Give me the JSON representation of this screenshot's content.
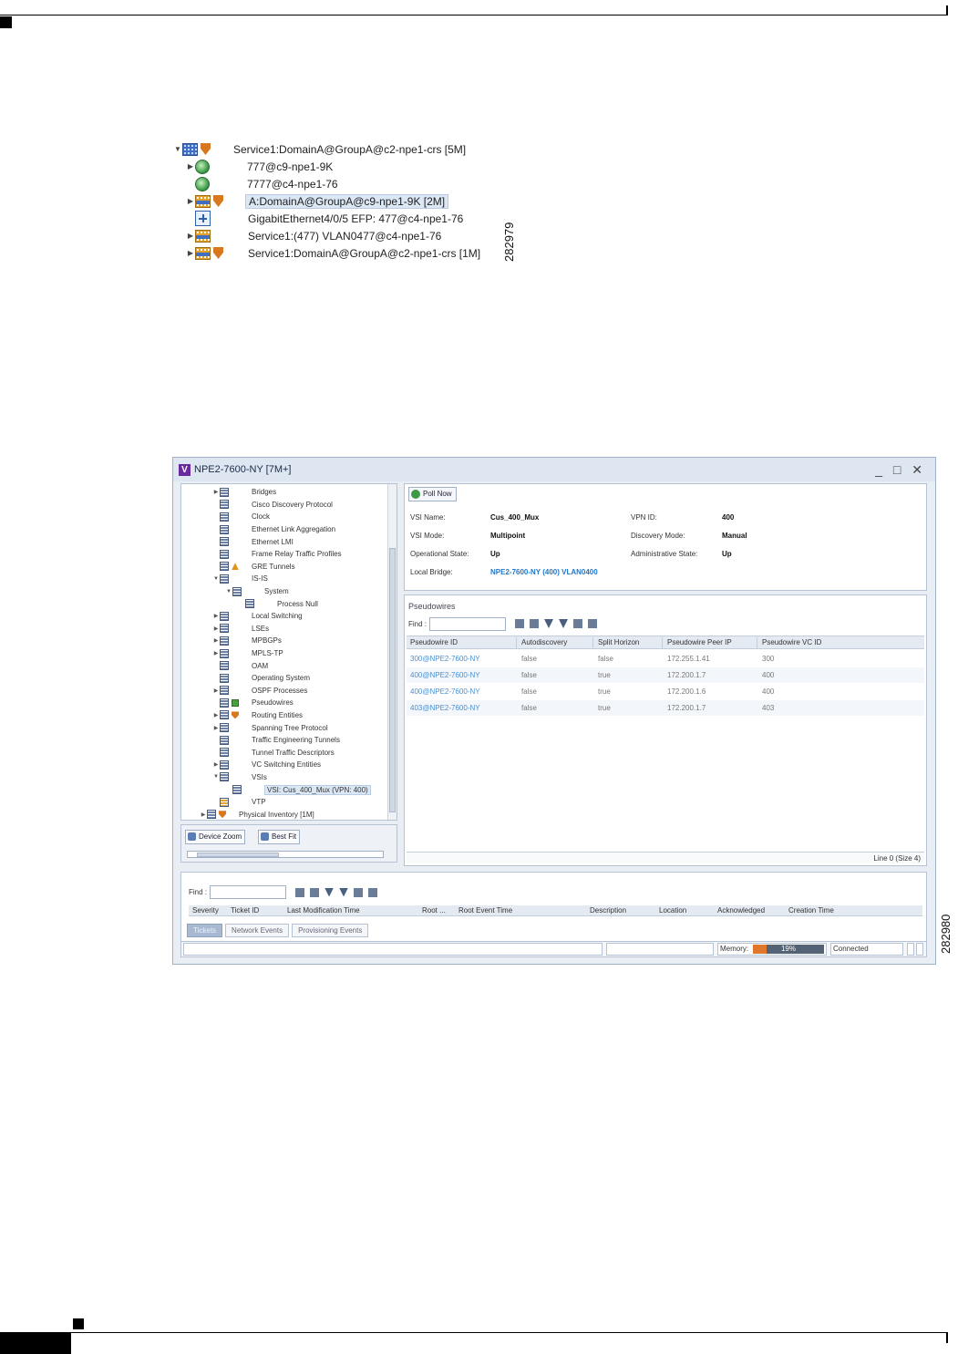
{
  "figure1": {
    "id": "282979",
    "rows": [
      {
        "label": "Service1:DomainA@GroupA@c2-npe1-crs [5M]",
        "arrow": "▼",
        "indent": 0,
        "icon": "service",
        "shield": true,
        "selected": false
      },
      {
        "label": "777@c9-npe1-9K",
        "arrow": "▶",
        "indent": 1,
        "icon": "globe",
        "shield": false,
        "selected": false
      },
      {
        "label": "7777@c4-npe1-76",
        "arrow": "",
        "indent": 1,
        "icon": "globe",
        "shield": false,
        "selected": false
      },
      {
        "label": "A:DomainA@GroupA@c9-npe1-9K [2M]",
        "arrow": "▶",
        "indent": 1,
        "icon": "service-orange",
        "shield": true,
        "selected": true
      },
      {
        "label": "GigabitEthernet4/0/5 EFP: 477@c4-npe1-76",
        "arrow": "",
        "indent": 1,
        "icon": "port",
        "shield": false,
        "selected": false
      },
      {
        "label": "Service1:(477) VLAN0477@c4-npe1-76",
        "arrow": "▶",
        "indent": 1,
        "icon": "service-orange",
        "shield": false,
        "selected": false
      },
      {
        "label": "Service1:DomainA@GroupA@c2-npe1-crs [1M]",
        "arrow": "▶",
        "indent": 1,
        "icon": "service-orange",
        "shield": true,
        "selected": false
      }
    ]
  },
  "figure2": {
    "id": "282980",
    "window": {
      "title": "NPE2-7600-NY [7M+]",
      "controls": "_ □ ✕"
    },
    "tree": [
      {
        "label": "Bridges",
        "arrow": "▶",
        "indent": 0,
        "badge": ""
      },
      {
        "label": "Cisco Discovery Protocol",
        "arrow": "",
        "indent": 0,
        "badge": ""
      },
      {
        "label": "Clock",
        "arrow": "",
        "indent": 0,
        "badge": ""
      },
      {
        "label": "Ethernet Link Aggregation",
        "arrow": "",
        "indent": 0,
        "badge": ""
      },
      {
        "label": "Ethernet LMI",
        "arrow": "",
        "indent": 0,
        "badge": ""
      },
      {
        "label": "Frame Relay Traffic Profiles",
        "arrow": "",
        "indent": 0,
        "badge": ""
      },
      {
        "label": "GRE Tunnels",
        "arrow": "",
        "indent": 0,
        "badge": "warn"
      },
      {
        "label": "IS-IS",
        "arrow": "▼",
        "indent": 0,
        "badge": ""
      },
      {
        "label": "System",
        "arrow": "▼",
        "indent": 1,
        "badge": ""
      },
      {
        "label": "Process Null",
        "arrow": "",
        "indent": 2,
        "badge": ""
      },
      {
        "label": "Local Switching",
        "arrow": "▶",
        "indent": 0,
        "badge": ""
      },
      {
        "label": "LSEs",
        "arrow": "▶",
        "indent": 0,
        "badge": ""
      },
      {
        "label": "MPBGPs",
        "arrow": "▶",
        "indent": 0,
        "badge": ""
      },
      {
        "label": "MPLS-TP",
        "arrow": "▶",
        "indent": 0,
        "badge": ""
      },
      {
        "label": "OAM",
        "arrow": "",
        "indent": 0,
        "badge": ""
      },
      {
        "label": "Operating System",
        "arrow": "",
        "indent": 0,
        "badge": ""
      },
      {
        "label": "OSPF Processes",
        "arrow": "▶",
        "indent": 0,
        "badge": ""
      },
      {
        "label": "Pseudowires",
        "arrow": "",
        "indent": 0,
        "badge": "green"
      },
      {
        "label": "Routing Entities",
        "arrow": "▶",
        "indent": 0,
        "badge": "shield"
      },
      {
        "label": "Spanning Tree Protocol",
        "arrow": "▶",
        "indent": 0,
        "badge": ""
      },
      {
        "label": "Traffic Engineering Tunnels",
        "arrow": "",
        "indent": 0,
        "badge": ""
      },
      {
        "label": "Tunnel Traffic Descriptors",
        "arrow": "",
        "indent": 0,
        "badge": ""
      },
      {
        "label": "VC Switching Entities",
        "arrow": "▶",
        "indent": 0,
        "badge": ""
      },
      {
        "label": "VSIs",
        "arrow": "▼",
        "indent": 0,
        "badge": ""
      },
      {
        "label": "VSI: Cus_400_Mux (VPN: 400)",
        "arrow": "",
        "indent": 1,
        "badge": "",
        "selected": true
      },
      {
        "label": "VTP",
        "arrow": "",
        "indent": 0,
        "badge": "",
        "orange": true
      },
      {
        "label": "Physical Inventory [1M]",
        "arrow": "▶",
        "indent": -1,
        "badge": "shield"
      }
    ],
    "left_tools": {
      "zoom": "Device Zoom",
      "fit": "Best Fit"
    },
    "props": {
      "poll": "Poll Now",
      "vsi_name_label": "VSI Name:",
      "vsi_name": "Cus_400_Mux",
      "vsi_mode_label": "VSI Mode:",
      "vsi_mode": "Multipoint",
      "op_state_label": "Operational State:",
      "op_state": "Up",
      "local_bridge_label": "Local Bridge:",
      "local_bridge": "NPE2-7600-NY (400) VLAN0400",
      "vpn_id_label": "VPN ID:",
      "vpn_id": "400",
      "disc_mode_label": "Discovery Mode:",
      "disc_mode": "Manual",
      "admin_state_label": "Administrative State:",
      "admin_state": "Up"
    },
    "pseudowires": {
      "title": "Pseudowires",
      "find_label": "Find :",
      "columns": [
        "Pseudowire ID",
        "Autodiscovery",
        "Split Horizon",
        "Pseudowire Peer IP",
        "Pseudowire VC ID"
      ],
      "rows": [
        [
          "300@NPE2-7600-NY",
          "false",
          "false",
          "172.255.1.41",
          "300"
        ],
        [
          "400@NPE2-7600-NY",
          "false",
          "true",
          "172.200.1.7",
          "400"
        ],
        [
          "400@NPE2-7600-NY",
          "false",
          "true",
          "172.200.1.6",
          "400"
        ],
        [
          "403@NPE2-7600-NY",
          "false",
          "true",
          "172.200.1.7",
          "403"
        ]
      ],
      "footer": "Line 0 (Size 4)"
    },
    "events": {
      "find_label": "Find :",
      "columns": [
        "Severity",
        "Ticket ID",
        "Last Modification Time",
        "Root ...",
        "Root Event Time",
        "Description",
        "Location",
        "Acknowledged",
        "Creation Time"
      ],
      "tabs": [
        "Tickets",
        "Network Events",
        "Provisioning Events"
      ]
    },
    "status": {
      "memory_label": "Memory:",
      "memory_percent": 19,
      "memory_text": "19%",
      "connection": "Connected"
    }
  }
}
